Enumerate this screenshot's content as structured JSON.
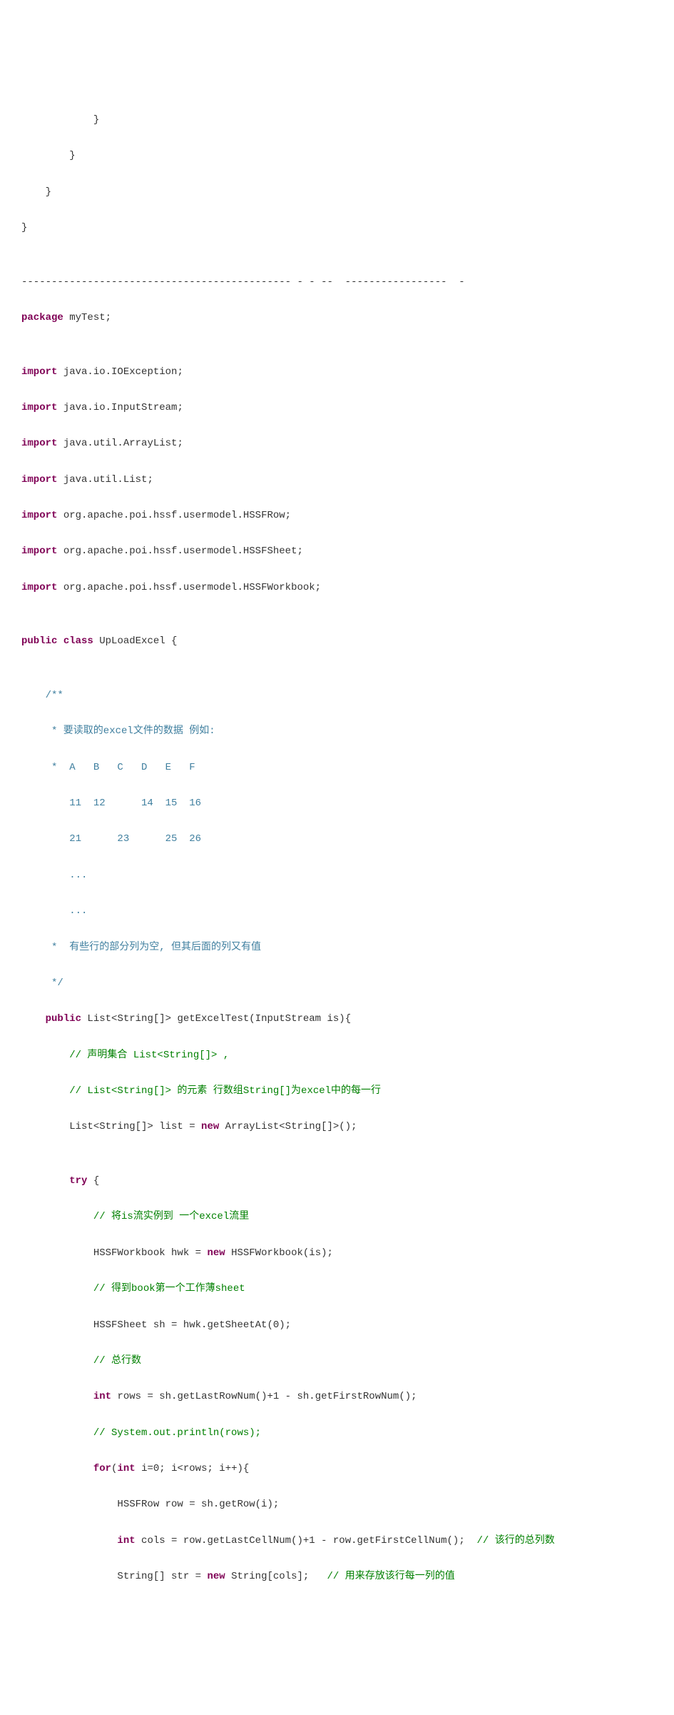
{
  "code": {
    "l1": "            }",
    "l2": "        }",
    "l3": "    }",
    "l4": "}",
    "l5": "",
    "l6": "--------------------------------------------- - - --  -----------------  -",
    "l7_kw": "package",
    "l7_rest": " myTest;",
    "l8": "",
    "l9_kw": "import",
    "l9_rest": " java.io.IOException;",
    "l10_kw": "import",
    "l10_rest": " java.io.InputStream;",
    "l11_kw": "import",
    "l11_rest": " java.util.ArrayList;",
    "l12_kw": "import",
    "l12_rest": " java.util.List;",
    "l13_kw": "import",
    "l13_rest": " org.apache.poi.hssf.usermodel.HSSFRow;",
    "l14_kw": "import",
    "l14_rest": " org.apache.poi.hssf.usermodel.HSSFSheet;",
    "l15_kw": "import",
    "l15_rest": " org.apache.poi.hssf.usermodel.HSSFWorkbook;",
    "l16": "",
    "l17_kw1": "public",
    "l17_sp1": " ",
    "l17_kw2": "class",
    "l17_rest": " UpLoadExcel {",
    "l18": "",
    "l19": "    /**",
    "l20": "     * 要读取的excel文件的数据 例如:",
    "l21": "     *  A   B   C   D   E   F",
    "l22": "        11  12      14  15  16",
    "l23": "        21      23      25  26",
    "l24": "        ...",
    "l25": "        ...",
    "l26": "     *  有些行的部分列为空, 但其后面的列又有值",
    "l27": "     */",
    "l28_pre": "    ",
    "l28_kw": "public",
    "l28_rest": " List<String[]> getExcelTest(InputStream is){",
    "l29": "        // 声明集合 List<String[]> ,",
    "l30": "        // List<String[]> 的元素 行数组String[]为excel中的每一行",
    "l31_a": "        List<String[]> list = ",
    "l31_kw": "new",
    "l31_b": " ArrayList<String[]>();",
    "l32": "",
    "l33_pre": "        ",
    "l33_kw": "try",
    "l33_rest": " {",
    "l34": "            // 将is流实例到 一个excel流里",
    "l35_a": "            HSSFWorkbook hwk = ",
    "l35_kw": "new",
    "l35_b": " HSSFWorkbook(is);",
    "l36": "            // 得到book第一个工作薄sheet",
    "l37": "            HSSFSheet sh = hwk.getSheetAt(0);",
    "l38": "            // 总行数",
    "l39_pre": "            ",
    "l39_kw": "int",
    "l39_rest": " rows = sh.getLastRowNum()+1 - sh.getFirstRowNum();",
    "l40": "            // System.out.println(rows);",
    "l41_pre": "            ",
    "l41_kw1": "for",
    "l41_a": "(",
    "l41_kw2": "int",
    "l41_b": " i=0; i<rows; i++){",
    "l42": "                HSSFRow row = sh.getRow(i);",
    "l43_pre": "                ",
    "l43_kw": "int",
    "l43_a": " cols = row.getLastCellNum()+1 - row.getFirstCellNum();  ",
    "l43_c": "// 该行的总列数",
    "l44_a": "                String[] str = ",
    "l44_kw": "new",
    "l44_b": " String[cols];   ",
    "l44_c": "// 用来存放该行每一列的值"
  }
}
